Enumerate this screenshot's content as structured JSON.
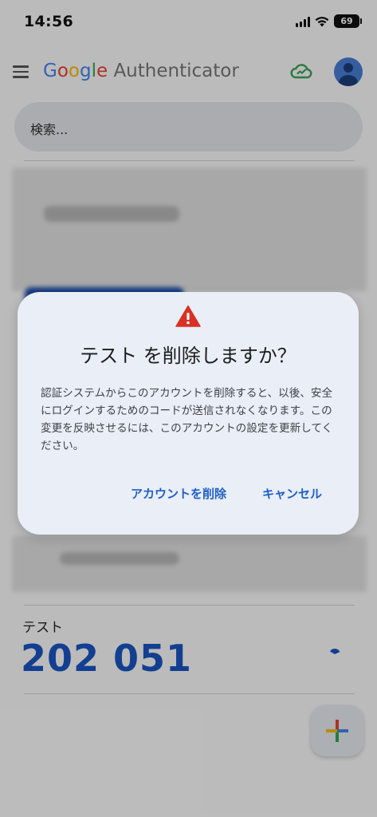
{
  "status_bar": {
    "time": "14:56",
    "battery": "69"
  },
  "app_bar": {
    "logo_word": "Google",
    "title_rest": "Authenticator",
    "menu_icon": "hamburger-menu-icon",
    "sync_icon": "cloud-sync-icon",
    "avatar_icon": "account-avatar-icon"
  },
  "search": {
    "placeholder": "検索..."
  },
  "account": {
    "name": "テスト",
    "code": "202 051",
    "timer_icon": "countdown-pie-icon"
  },
  "fab": {
    "icon": "plus-icon"
  },
  "dialog": {
    "icon": "warning-triangle-icon",
    "title": "テスト を削除しますか？",
    "message": "認証システムからこのアカウントを削除すると、以後、安全にログインするためのコードが送信されなくなります。この変更を反映させるには、このアカウントの設定を更新してください。",
    "confirm_label": "アカウントを削除",
    "cancel_label": "キャンセル"
  },
  "colors": {
    "accent": "#1f5fc4",
    "code": "#1a56c4",
    "warning": "#d93025",
    "dialog_bg": "#e9eef7"
  }
}
